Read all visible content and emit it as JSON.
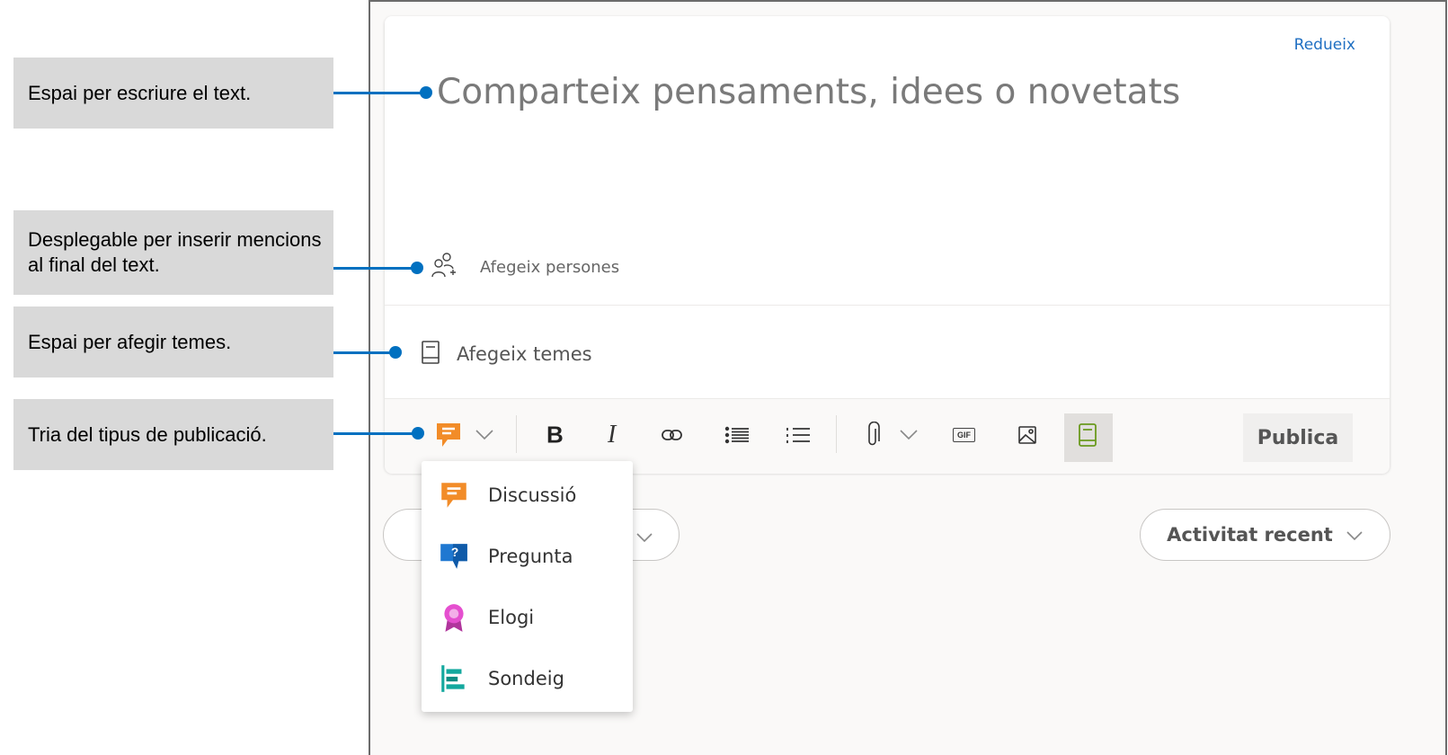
{
  "callouts": [
    "Espai per escriure el text.",
    "Desplegable per inserir mencions al final del text.",
    "Espai per afegir temes.",
    "Tria del tipus de publicació."
  ],
  "composer": {
    "collapse_label": "Redueix",
    "placeholder": "Comparteix pensaments, idees o novetats",
    "add_people_label": "Afegeix persones",
    "add_topics_label": "Afegeix temes"
  },
  "toolbar": {
    "publish_label": "Publica",
    "gif_label": "GIF"
  },
  "feed": {
    "sort_label": "Activitat recent"
  },
  "post_type_menu": [
    {
      "label": "Discussió",
      "icon": "discussion-icon",
      "color": "#f28c28"
    },
    {
      "label": "Pregunta",
      "icon": "question-icon",
      "color": "#1f78d1"
    },
    {
      "label": "Elogi",
      "icon": "praise-icon",
      "color": "#d13fb0"
    },
    {
      "label": "Sondeig",
      "icon": "poll-icon",
      "color": "#13a89e"
    }
  ],
  "colors": {
    "callout_line": "#0070c0",
    "callout_bg": "#d9d9d9",
    "link": "#1f6fc2"
  }
}
